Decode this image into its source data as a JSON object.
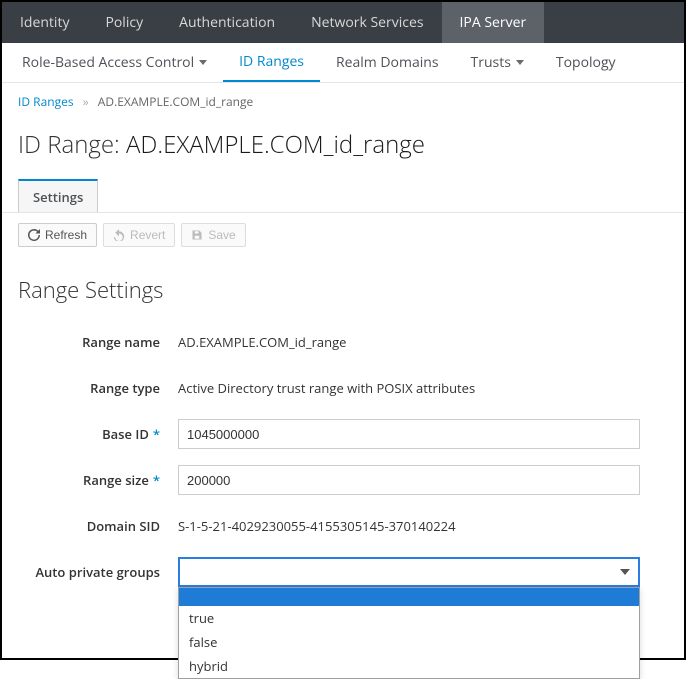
{
  "topnav": {
    "items": [
      "Identity",
      "Policy",
      "Authentication",
      "Network Services",
      "IPA Server"
    ],
    "active_index": 4
  },
  "subnav": {
    "items": [
      {
        "label": "Role-Based Access Control",
        "dropdown": true
      },
      {
        "label": "ID Ranges"
      },
      {
        "label": "Realm Domains"
      },
      {
        "label": "Trusts",
        "dropdown": true
      },
      {
        "label": "Topology"
      }
    ],
    "active_index": 1
  },
  "breadcrumb": {
    "root": "ID Ranges",
    "current": "AD.EXAMPLE.COM_id_range"
  },
  "title": {
    "prefix": "ID Range: ",
    "name": "AD.EXAMPLE.COM_id_range"
  },
  "inner_tab": "Settings",
  "toolbar": {
    "refresh": "Refresh",
    "revert": "Revert",
    "save": "Save"
  },
  "section_heading": "Range Settings",
  "form": {
    "range_name": {
      "label": "Range name",
      "value": "AD.EXAMPLE.COM_id_range"
    },
    "range_type": {
      "label": "Range type",
      "value": "Active Directory trust range with POSIX attributes"
    },
    "base_id": {
      "label": "Base ID",
      "value": "1045000000",
      "required": true
    },
    "range_size": {
      "label": "Range size",
      "value": "200000",
      "required": true
    },
    "domain_sid": {
      "label": "Domain SID",
      "value": "S-1-5-21-4029230055-4155305145-370140224"
    },
    "auto_private_groups": {
      "label": "Auto private groups",
      "selected": "",
      "options": [
        "",
        "true",
        "false",
        "hybrid"
      ]
    }
  }
}
